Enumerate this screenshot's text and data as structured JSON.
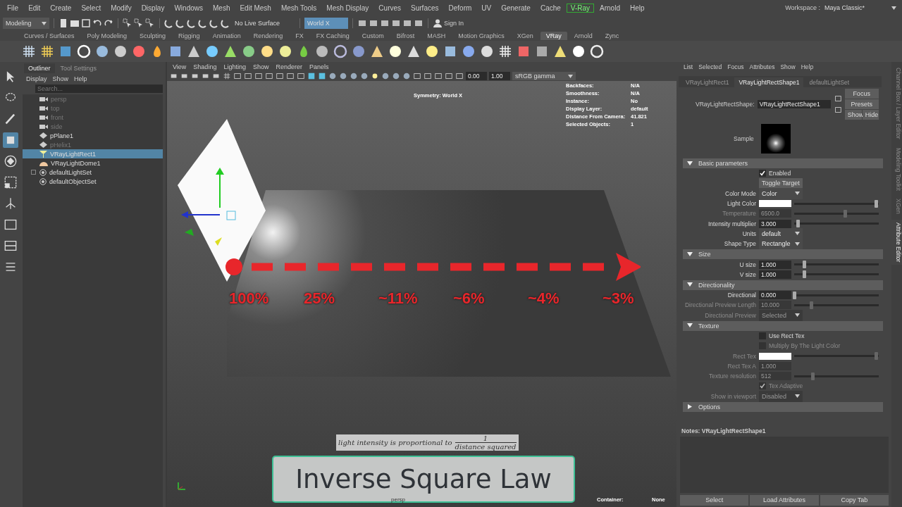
{
  "menu_bar": {
    "items": [
      {
        "label": "File",
        "highlighted": false
      },
      {
        "label": "Edit",
        "highlighted": false
      },
      {
        "label": "Create",
        "highlighted": false
      },
      {
        "label": "Select",
        "highlighted": false
      },
      {
        "label": "Modify",
        "highlighted": false
      },
      {
        "label": "Display",
        "highlighted": false
      },
      {
        "label": "Windows",
        "highlighted": false
      },
      {
        "label": "Mesh",
        "highlighted": false
      },
      {
        "label": "Edit Mesh",
        "highlighted": false
      },
      {
        "label": "Mesh Tools",
        "highlighted": false
      },
      {
        "label": "Mesh Display",
        "highlighted": false
      },
      {
        "label": "Curves",
        "highlighted": false
      },
      {
        "label": "Surfaces",
        "highlighted": false
      },
      {
        "label": "Deform",
        "highlighted": false
      },
      {
        "label": "UV",
        "highlighted": false
      },
      {
        "label": "Generate",
        "highlighted": false
      },
      {
        "label": "Cache",
        "highlighted": false
      },
      {
        "label": "V-Ray",
        "highlighted": true
      },
      {
        "label": "Arnold",
        "highlighted": false
      },
      {
        "label": "Help",
        "highlighted": false
      }
    ],
    "workspace_label": "Workspace :",
    "workspace": "Maya Classic*"
  },
  "status_line": {
    "mode": "Modeling",
    "live_surface": "No Live Surface",
    "symmetry": "World X",
    "sign_in": "Sign In"
  },
  "shelf_tabs": [
    {
      "label": "Curves / Surfaces",
      "selected": false
    },
    {
      "label": "Poly Modeling",
      "selected": false
    },
    {
      "label": "Sculpting",
      "selected": false
    },
    {
      "label": "Rigging",
      "selected": false
    },
    {
      "label": "Animation",
      "selected": false
    },
    {
      "label": "Rendering",
      "selected": false
    },
    {
      "label": "FX",
      "selected": false
    },
    {
      "label": "FX Caching",
      "selected": false
    },
    {
      "label": "Custom",
      "selected": false
    },
    {
      "label": "Bifrost",
      "selected": false
    },
    {
      "label": "MASH",
      "selected": false
    },
    {
      "label": "Motion Graphics",
      "selected": false
    },
    {
      "label": "XGen",
      "selected": false
    },
    {
      "label": "VRay",
      "selected": true
    },
    {
      "label": "Arnold",
      "selected": false
    },
    {
      "label": "Zync",
      "selected": false
    }
  ],
  "outliner": {
    "tabs": [
      {
        "label": "Outliner",
        "selected": true
      },
      {
        "label": "Tool Settings",
        "selected": false
      }
    ],
    "menu": [
      "Display",
      "Show",
      "Help"
    ],
    "search": {
      "placeholder": "Search..."
    },
    "items": [
      {
        "name": "persp",
        "kind": "camera",
        "hidden": true,
        "selected": false
      },
      {
        "name": "top",
        "kind": "camera",
        "hidden": true,
        "selected": false
      },
      {
        "name": "front",
        "kind": "camera",
        "hidden": true,
        "selected": false
      },
      {
        "name": "side",
        "kind": "camera",
        "hidden": true,
        "selected": false
      },
      {
        "name": "pPlane1",
        "kind": "mesh",
        "hidden": false,
        "selected": false
      },
      {
        "name": "pHelix1",
        "kind": "mesh",
        "hidden": true,
        "selected": false
      },
      {
        "name": "VRayLightRect1",
        "kind": "rectlight",
        "hidden": false,
        "selected": true
      },
      {
        "name": "VRayLightDome1",
        "kind": "domelight",
        "hidden": false,
        "selected": false
      },
      {
        "name": "defaultLightSet",
        "kind": "set",
        "hidden": false,
        "selected": false,
        "expanded": false
      },
      {
        "name": "defaultObjectSet",
        "kind": "set",
        "hidden": false,
        "selected": false
      }
    ]
  },
  "viewport": {
    "menu": [
      "View",
      "Shading",
      "Lighting",
      "Show",
      "Renderer",
      "Panels"
    ],
    "exposure": "0.00",
    "gamma": "1.00",
    "color_space": "sRGB gamma",
    "hud": {
      "symmetry": "Symmetry: World X",
      "stats": [
        {
          "label": "Backfaces:",
          "value": "N/A"
        },
        {
          "label": "Smoothness:",
          "value": "N/A"
        },
        {
          "label": "Instance:",
          "value": "No"
        },
        {
          "label": "Display Layer:",
          "value": "default"
        },
        {
          "label": "Distance From Camera:",
          "value": "41.821"
        },
        {
          "label": "Selected Objects:",
          "value": "1"
        }
      ]
    },
    "distance_labels": [
      "100%",
      "25%",
      "~11%",
      "~6%",
      "~4%",
      "~3%"
    ],
    "formula": {
      "text": "light intensity is proportional to",
      "numerator": "1",
      "denominator": "distance squared"
    },
    "title_card": "Inverse Square Law",
    "camera": "persp",
    "container_label": "Container:",
    "container_value": "None"
  },
  "attribute_editor": {
    "menu": [
      "List",
      "Selected",
      "Focus",
      "Attributes",
      "Show",
      "Help"
    ],
    "tabs": [
      {
        "label": "VRayLightRect1",
        "selected": false
      },
      {
        "label": "VRayLightRectShape1",
        "selected": true
      },
      {
        "label": "defaultLightSet",
        "selected": false
      }
    ],
    "node_label": "VRayLightRectShape:",
    "node_name": "VRayLightRectShape1",
    "buttons": [
      "Focus",
      "Presets",
      "Show",
      "Hide"
    ],
    "sample_label": "Sample",
    "sections": [
      {
        "title": "Basic parameters",
        "expanded": true,
        "rows": [
          {
            "kind": "checkbox",
            "label": "Enabled",
            "checked": true,
            "disabled": false
          },
          {
            "kind": "button",
            "label": "Toggle Target",
            "disabled": false
          },
          {
            "kind": "dropdown",
            "label": "Color Mode",
            "value": "Color",
            "disabled": false
          },
          {
            "kind": "color",
            "label": "Light Color",
            "level": 0.97,
            "disabled": false
          },
          {
            "kind": "number",
            "label": "Temperature",
            "value": "6500.0",
            "level": 0.6,
            "disabled": true
          },
          {
            "kind": "number",
            "label": "Intensity multiplier",
            "value": "3.000",
            "level": 0.04,
            "disabled": false
          },
          {
            "kind": "dropdown",
            "label": "Units",
            "value": "default",
            "disabled": false
          },
          {
            "kind": "dropdown",
            "label": "Shape Type",
            "value": "Rectangle",
            "disabled": false
          }
        ]
      },
      {
        "title": "Size",
        "expanded": true,
        "rows": [
          {
            "kind": "number",
            "label": "U size",
            "value": "1.000",
            "level": 0.12,
            "disabled": false
          },
          {
            "kind": "number",
            "label": "V size",
            "value": "1.000",
            "level": 0.12,
            "disabled": false
          }
        ]
      },
      {
        "title": "Directionality",
        "expanded": true,
        "rows": [
          {
            "kind": "number",
            "label": "Directional",
            "value": "0.000",
            "level": 0.0,
            "disabled": false
          },
          {
            "kind": "number",
            "label": "Directional Preview Length",
            "value": "10.000",
            "level": 0.2,
            "disabled": true
          },
          {
            "kind": "dropdown",
            "label": "Directional Preview",
            "value": "Selected",
            "disabled": true
          }
        ]
      },
      {
        "title": "Texture",
        "expanded": true,
        "rows": [
          {
            "kind": "checkbox",
            "label": "Use Rect Tex",
            "checked": false,
            "disabled": false
          },
          {
            "kind": "checkbox",
            "label": "Multiply By The Light Color",
            "checked": false,
            "disabled": true
          },
          {
            "kind": "color",
            "label": "Rect Tex",
            "level": 0.97,
            "disabled": true
          },
          {
            "kind": "number",
            "label": "Rect Tex A",
            "value": "1.000",
            "disabled": true
          },
          {
            "kind": "number",
            "label": "Texture resolution",
            "value": "512",
            "level": 0.22,
            "disabled": true
          },
          {
            "kind": "checkbox",
            "label": "Tex Adaptive",
            "checked": true,
            "disabled": true
          },
          {
            "kind": "dropdown",
            "label": "Show in viewport",
            "value": "Disabled",
            "disabled": true
          }
        ]
      },
      {
        "title": "Options",
        "expanded": false
      }
    ],
    "notes_label": "Notes:  VRayLightRectShape1",
    "bottom_buttons": [
      "Select",
      "Load Attributes",
      "Copy Tab"
    ]
  },
  "side_tabs": [
    {
      "label": "Channel Box / Layer Editor",
      "selected": false
    },
    {
      "label": "Modeling Toolkit",
      "selected": false
    },
    {
      "label": "XGen",
      "selected": false
    },
    {
      "label": "Attribute Editor",
      "selected": true
    }
  ]
}
